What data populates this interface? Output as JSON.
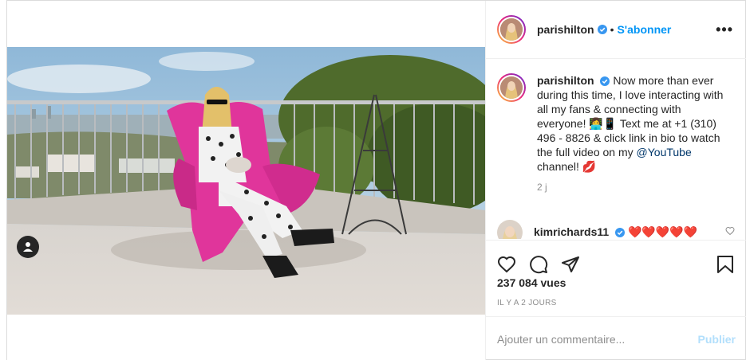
{
  "post": {
    "username": "parishilton",
    "follow_label": "S'abonner",
    "separator": "•",
    "more_label": "•••"
  },
  "caption": {
    "username": "parishilton",
    "text_part1": "Now more than ever during this time, I love interacting with all my fans & connecting with everyone!",
    "emoji": "👩‍💻📱",
    "text_part2": "Text me at +1 (310) 496 - 8826 & click link in bio to watch the full video on my",
    "mention": "@YouTube",
    "text_part3": "channel!",
    "emoji_end": "💋",
    "time": "2 j"
  },
  "comment": {
    "username": "kimrichards11",
    "text": "❤️❤️❤️❤️❤️"
  },
  "stats": {
    "views": "237 084 vues",
    "date": "IL Y A 2 JOURS"
  },
  "add_comment": {
    "placeholder": "Ajouter un commentaire...",
    "publish_label": "Publier"
  },
  "colors": {
    "accent": "#0095f6",
    "verified": "#3897f0",
    "publish_disabled": "#b2dffc",
    "chair": "#e0359b"
  }
}
